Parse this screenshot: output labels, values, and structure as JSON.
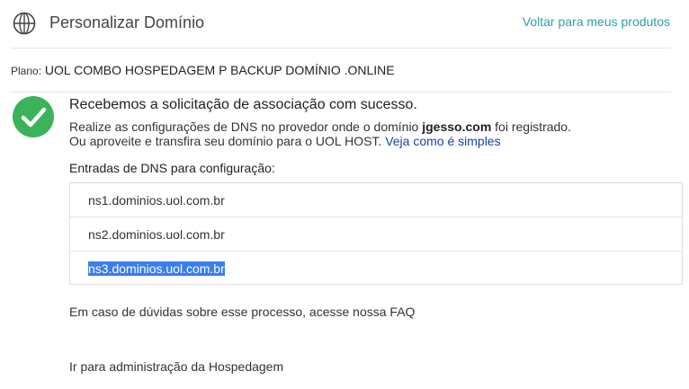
{
  "header": {
    "title": "Personalizar Domínio",
    "back_link": "Voltar para meus produtos"
  },
  "plan": {
    "label": "Plano:",
    "value": "UOL COMBO HOSPEDAGEM P BACKUP DOMÍNIO .ONLINE"
  },
  "message": {
    "title": "Recebemos a solicitação de associação com sucesso.",
    "line1_prefix": "Realize as configurações de DNS no provedor onde o domínio ",
    "domain": "jgesso.com",
    "line1_suffix": " foi registrado.",
    "line2_prefix": "Ou aproveite e transfira seu domínio para o UOL HOST. ",
    "how_link": "Veja como é simples"
  },
  "dns": {
    "label": "Entradas de DNS para configuração:",
    "entries": [
      "ns1.dominios.uol.com.br",
      "ns2.dominios.uol.com.br",
      "ns3.dominios.uol.com.br"
    ]
  },
  "faq": "Em caso de dúvidas sobre esse processo, acesse nossa FAQ",
  "admin_link": "Ir para administração da Hospedagem",
  "colors": {
    "accent_link": "#2aa1a8",
    "success_green": "#3bb35a",
    "selection": "#3b7ded"
  },
  "icons": {
    "header": "globe-icon",
    "status": "check-circle-icon"
  }
}
